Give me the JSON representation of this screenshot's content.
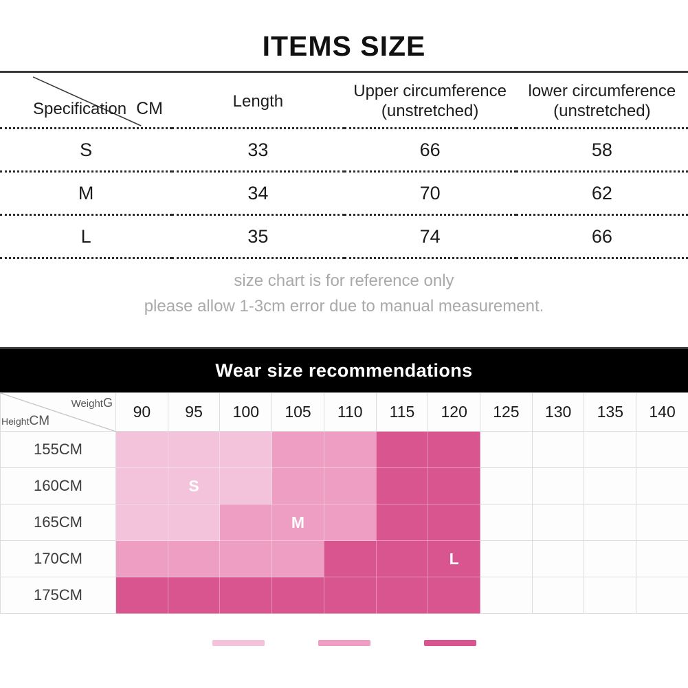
{
  "items_size": {
    "title": "ITEMS SIZE",
    "corner_label": "Specification",
    "corner_unit": "CM",
    "columns": [
      {
        "line1": "Length",
        "line2": ""
      },
      {
        "line1": "Upper circumference",
        "line2": "(unstretched)"
      },
      {
        "line1": "lower circumference",
        "line2": "(unstretched)"
      }
    ],
    "rows": [
      {
        "size": "S",
        "length": "33",
        "upper": "66",
        "lower": "58"
      },
      {
        "size": "M",
        "length": "34",
        "upper": "70",
        "lower": "62"
      },
      {
        "size": "L",
        "length": "35",
        "upper": "74",
        "lower": "66"
      }
    ],
    "disclaimer_line1": "size chart is for reference only",
    "disclaimer_line2": "please allow 1-3cm error due to manual measurement."
  },
  "wear_size": {
    "banner_title": "Wear size recommendations",
    "corner_weight_label": "Weight",
    "corner_weight_unit": "G",
    "corner_height_label": "Height",
    "corner_height_unit": "CM",
    "weights": [
      "90",
      "95",
      "100",
      "105",
      "110",
      "115",
      "120",
      "125",
      "130",
      "135",
      "140"
    ],
    "heights": [
      "155CM",
      "160CM",
      "165CM",
      "170CM",
      "175CM"
    ],
    "grid": [
      [
        "S",
        "S",
        "S",
        "M",
        "M",
        "L",
        "L",
        "",
        "",
        "",
        ""
      ],
      [
        "S",
        "S",
        "S",
        "M",
        "M",
        "L",
        "L",
        "",
        "",
        "",
        ""
      ],
      [
        "S",
        "S",
        "M",
        "M",
        "M",
        "L",
        "L",
        "",
        "",
        "",
        ""
      ],
      [
        "M",
        "M",
        "M",
        "M",
        "L",
        "L",
        "L",
        "",
        "",
        "",
        ""
      ],
      [
        "L",
        "L",
        "L",
        "L",
        "L",
        "L",
        "L",
        "",
        "",
        "",
        ""
      ]
    ],
    "labels": [
      {
        "row": 1,
        "col": 1,
        "text": "S"
      },
      {
        "row": 2,
        "col": 3,
        "text": "M"
      },
      {
        "row": 3,
        "col": 6,
        "text": "L"
      }
    ],
    "legend": [
      {
        "size": "S",
        "color": "#F2C3DA"
      },
      {
        "size": "M",
        "color": "#EE9EC2"
      },
      {
        "size": "L",
        "color": "#D9558F"
      }
    ]
  },
  "colors": {
    "size_s": "#F2C3DA",
    "size_m": "#EE9EC2",
    "size_l": "#D9558F",
    "empty": "#fdfdfd",
    "banner_bg": "#000000",
    "rule": "#3a3a3a",
    "muted_text": "#a9a9a9"
  }
}
